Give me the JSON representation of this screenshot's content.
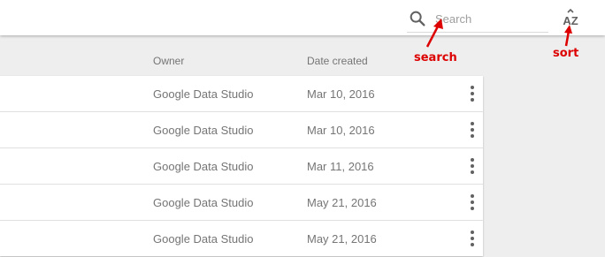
{
  "toolbar": {
    "search_placeholder": "Search",
    "search_icon": "search-icon",
    "sort_icon": "sort-az-icon"
  },
  "columns": {
    "owner": "Owner",
    "date_created": "Date created"
  },
  "rows": [
    {
      "owner": "Google Data Studio",
      "date": "Mar 10, 2016"
    },
    {
      "owner": "Google Data Studio",
      "date": "Mar 10, 2016"
    },
    {
      "owner": "Google Data Studio",
      "date": "Mar 11, 2016"
    },
    {
      "owner": "Google Data Studio",
      "date": "May 21, 2016"
    },
    {
      "owner": "Google Data Studio",
      "date": "May 21, 2016"
    }
  ],
  "annotations": {
    "search": "search",
    "sort": "sort",
    "color": "#dd0000"
  }
}
